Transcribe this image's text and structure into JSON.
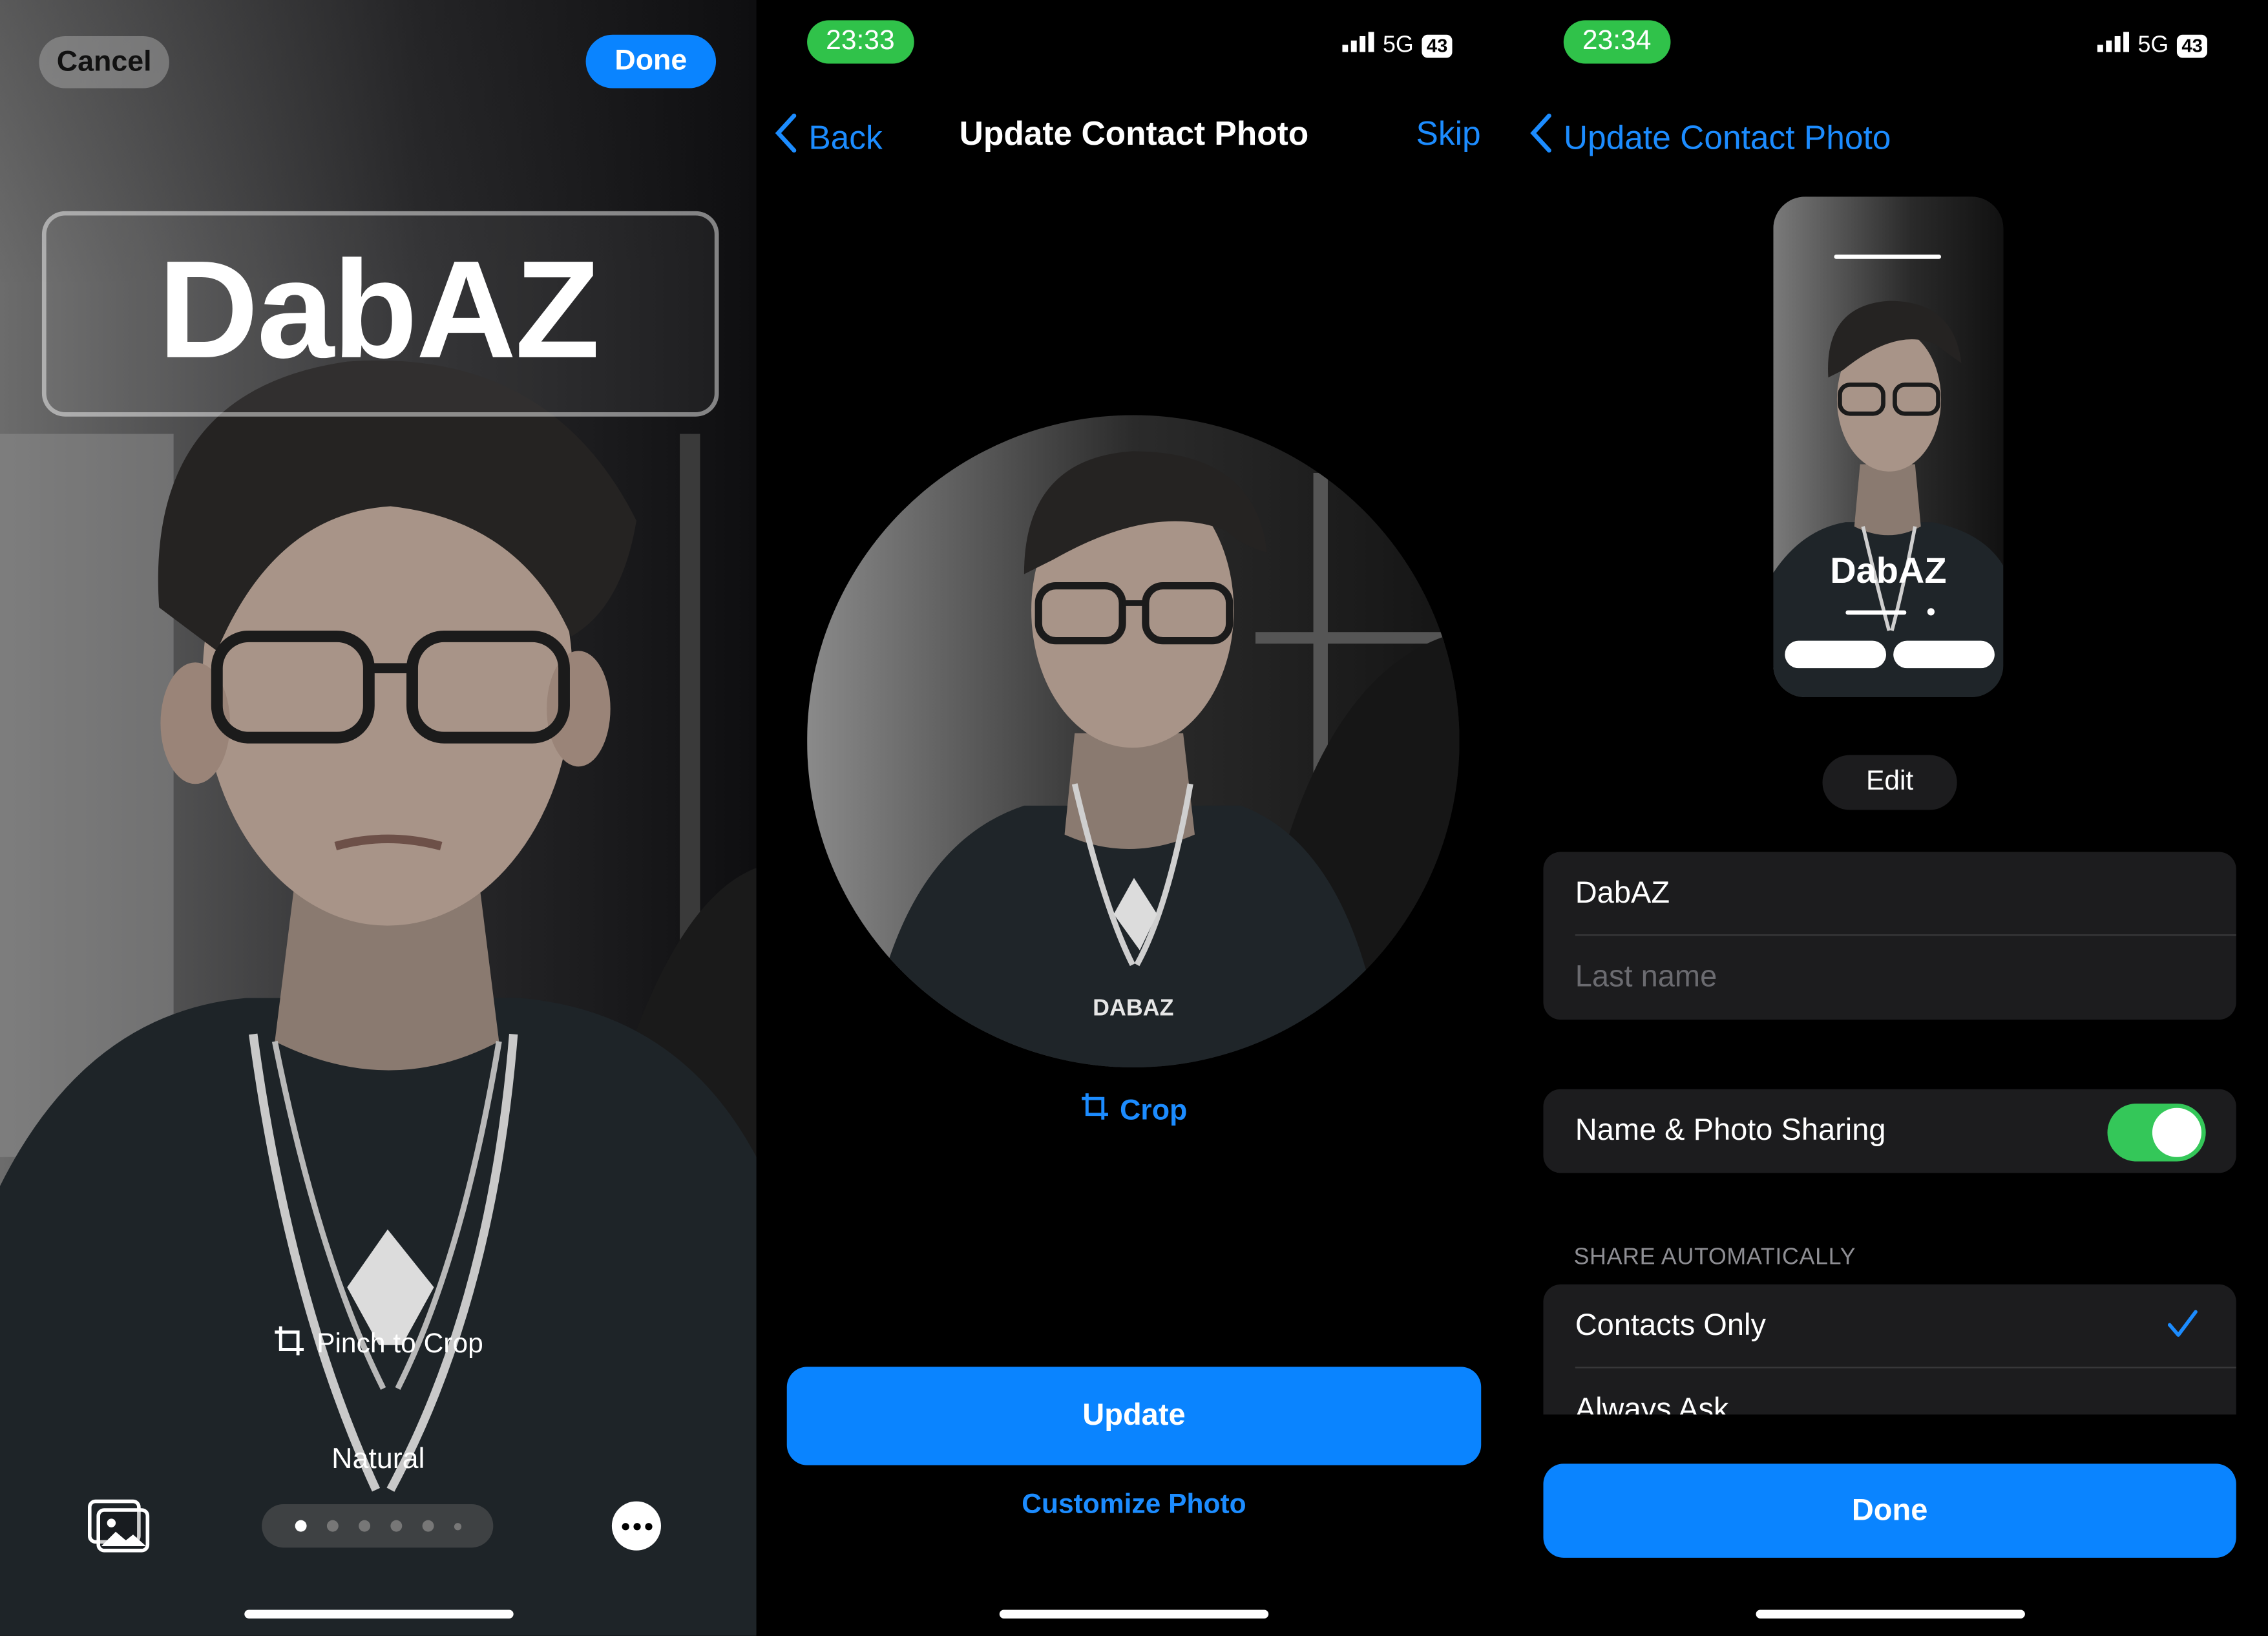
{
  "panel1": {
    "cancel_label": "Cancel",
    "done_label": "Done",
    "name_text": "DabAZ",
    "crop_hint": "Pinch to Crop",
    "filter_label": "Natural",
    "page_dots": {
      "count": 6,
      "active": 0
    },
    "gallery_icon": "photo-gallery-icon",
    "more_icon": "ellipsis-icon"
  },
  "panel2": {
    "time": "23:33",
    "network": "5G",
    "battery": "43",
    "back_label": "Back",
    "title": "Update Contact Photo",
    "skip_label": "Skip",
    "crop_label": "Crop",
    "shirt_text": "DABAZ",
    "update_label": "Update",
    "customize_label": "Customize Photo"
  },
  "panel3": {
    "time": "23:34",
    "network": "5G",
    "battery": "43",
    "back_label": "Update Contact Photo",
    "poster_name": "DabAZ",
    "edit_label": "Edit",
    "first_name_value": "DabAZ",
    "last_name_placeholder": "Last name",
    "sharing_label": "Name & Photo Sharing",
    "sharing_enabled": true,
    "share_section_header": "SHARE AUTOMATICALLY",
    "share_options": [
      "Contacts Only",
      "Always Ask"
    ],
    "selected_option": "Contacts Only",
    "done_label": "Done"
  },
  "colors": {
    "accent": "#0a84ff",
    "link": "#1c8cff",
    "status_green": "#30c24a",
    "toggle_on": "#34c759",
    "cell_bg": "#1c1c1e"
  }
}
